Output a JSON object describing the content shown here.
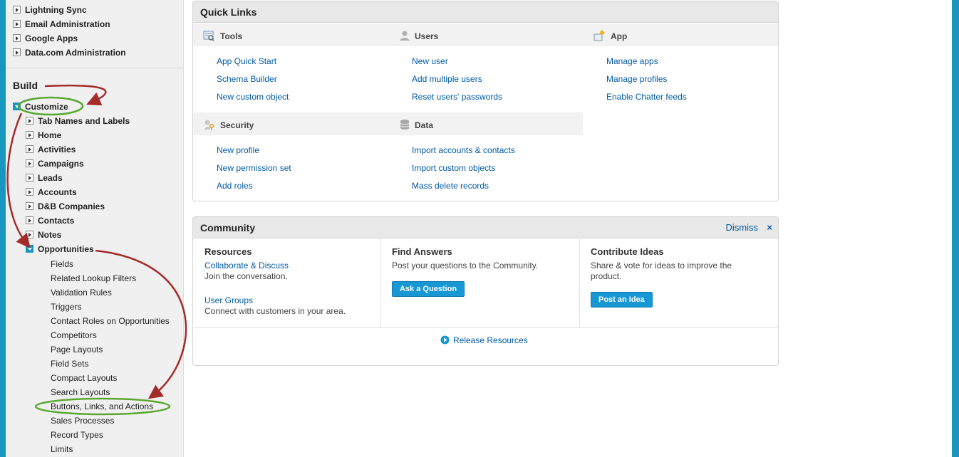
{
  "sidebar": {
    "top_items": [
      "Lightning Sync",
      "Email Administration",
      "Google Apps",
      "Data.com Administration"
    ],
    "build_heading": "Build",
    "customize_label": "Customize",
    "customize_children": [
      "Tab Names and Labels",
      "Home",
      "Activities",
      "Campaigns",
      "Leads",
      "Accounts",
      "D&B Companies",
      "Contacts",
      "Notes"
    ],
    "opportunities_label": "Opportunities",
    "opportunities_children": [
      "Fields",
      "Related Lookup Filters",
      "Validation Rules",
      "Triggers",
      "Contact Roles on Opportunities",
      "Competitors",
      "Page Layouts",
      "Field Sets",
      "Compact Layouts",
      "Search Layouts",
      "Buttons, Links, and Actions",
      "Sales Processes",
      "Record Types",
      "Limits"
    ]
  },
  "quick_links": {
    "title": "Quick Links",
    "tools": {
      "title": "Tools",
      "icon": "tools-icon",
      "links": [
        "App Quick Start",
        "Schema Builder",
        "New custom object"
      ]
    },
    "users": {
      "title": "Users",
      "icon": "user-icon",
      "links": [
        "New user",
        "Add multiple users",
        "Reset users' passwords"
      ]
    },
    "app": {
      "title": "App",
      "icon": "app-icon",
      "links": [
        "Manage apps",
        "Manage profiles",
        "Enable Chatter feeds"
      ]
    },
    "security": {
      "title": "Security",
      "icon": "key-icon",
      "links": [
        "New profile",
        "New permission set",
        "Add roles"
      ]
    },
    "data": {
      "title": "Data",
      "icon": "database-icon",
      "links": [
        "Import accounts & contacts",
        "Import custom objects",
        "Mass delete records"
      ]
    }
  },
  "community": {
    "title": "Community",
    "dismiss_label": "Dismiss",
    "dismiss_x": "×",
    "resources": {
      "title": "Resources",
      "link1": "Collaborate & Discuss",
      "text1": "Join the conversation.",
      "link2": "User Groups",
      "text2": "Connect with customers in your area."
    },
    "find_answers": {
      "title": "Find Answers",
      "text": "Post your questions to the Community.",
      "button": "Ask a Question"
    },
    "contribute": {
      "title": "Contribute Ideas",
      "text": "Share & vote for ideas to improve the product.",
      "button": "Post an Idea"
    },
    "release_resources": "Release Resources"
  },
  "colors": {
    "background": "#1797c0",
    "link": "#015ba7",
    "button": "#1797d4",
    "annotation_arrow": "#a52a2a",
    "annotation_ellipse": "#5aa832"
  }
}
